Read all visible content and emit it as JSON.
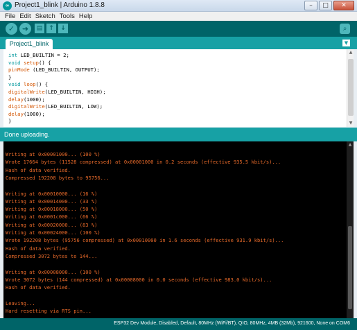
{
  "window": {
    "title": "Project1_blink | Arduino 1.8.8",
    "icon": "arduino-logo-icon",
    "controls": [
      "minimize-icon",
      "maximize-icon",
      "close-icon"
    ]
  },
  "menu": [
    "File",
    "Edit",
    "Sketch",
    "Tools",
    "Help"
  ],
  "toolbar": {
    "buttons": [
      "verify-icon",
      "upload-icon",
      "new-icon",
      "open-icon",
      "save-icon"
    ],
    "serial_monitor": "serial-monitor-icon"
  },
  "tabs": [
    {
      "label": "Project1_blink",
      "active": true
    }
  ],
  "editor": {
    "lines": [
      [
        {
          "t": "int",
          "c": "type"
        },
        {
          "t": " LED_BUILTIN = 2;",
          "c": ""
        }
      ],
      [
        {
          "t": "void",
          "c": "type"
        },
        {
          "t": " ",
          "c": ""
        },
        {
          "t": "setup",
          "c": "func"
        },
        {
          "t": "() {",
          "c": ""
        }
      ],
      [
        {
          "t": "pinMode",
          "c": "func"
        },
        {
          "t": " (LED_BUILTIN, OUTPUT);",
          "c": ""
        }
      ],
      [
        {
          "t": "}",
          "c": ""
        }
      ],
      [
        {
          "t": "void",
          "c": "type"
        },
        {
          "t": " ",
          "c": ""
        },
        {
          "t": "loop",
          "c": "func"
        },
        {
          "t": "() {",
          "c": ""
        }
      ],
      [
        {
          "t": "digitalWrite",
          "c": "func"
        },
        {
          "t": "(LED_BUILTIN, HIGH);",
          "c": ""
        }
      ],
      [
        {
          "t": "delay",
          "c": "func"
        },
        {
          "t": "(1000);",
          "c": ""
        }
      ],
      [
        {
          "t": "digitalWrite",
          "c": "func"
        },
        {
          "t": "(LED_BUILTIN, LOW);",
          "c": ""
        }
      ],
      [
        {
          "t": "delay",
          "c": "func"
        },
        {
          "t": "(1000);",
          "c": ""
        }
      ],
      [
        {
          "t": "}",
          "c": ""
        }
      ]
    ]
  },
  "status": "Done uploading.",
  "console": {
    "lines": [
      "Writing at 0x00001000... (100 %)",
      "Wrote 17664 bytes (11528 compressed) at 0x00001000 in 0.2 seconds (effective 935.5 kbit/s)...",
      "Hash of data verified.",
      "Compressed 192208 bytes to 95756...",
      "",
      "Writing at 0x00010000... (16 %)",
      "Writing at 0x00014000... (33 %)",
      "Writing at 0x00018000... (50 %)",
      "Writing at 0x0001c000... (66 %)",
      "Writing at 0x00020000... (83 %)",
      "Writing at 0x00024000... (100 %)",
      "Wrote 192208 bytes (95756 compressed) at 0x00010000 in 1.6 seconds (effective 931.9 kbit/s)...",
      "Hash of data verified.",
      "Compressed 3072 bytes to 144...",
      "",
      "Writing at 0x00008000... (100 %)",
      "Wrote 3072 bytes (144 compressed) at 0x00008000 in 0.0 seconds (effective 983.0 kbit/s)...",
      "Hash of data verified.",
      "",
      "Leaving...",
      "Hard resetting via RTS pin..."
    ]
  },
  "footer": "ESP32 Dev Module, Disabled, Default, 80MHz (WiFi/BT), QIO, 80MHz, 4MB (32Mb), 921600, None on COM6",
  "colors": {
    "toolbar_bg": "#006468",
    "accent": "#17a1a5",
    "console_text": "#e86a2a",
    "keyword_type": "#00979c",
    "keyword_func": "#d35400"
  }
}
